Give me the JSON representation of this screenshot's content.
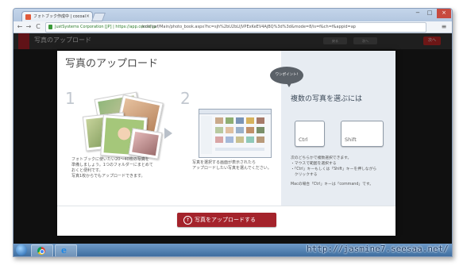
{
  "browser": {
    "tab_title": "フォトブック作成中 | cocoal",
    "close_glyph": "×",
    "url_secure": "JustSystems Corporation [JP] | https://app.cocoal.jp",
    "url_rest": "/edit/swf/Main/photo_book.aspx?hc=sjh%2bU2bLIJVPExKeEV4AjBQ%3d%3d&mode=8/is=f&ch=f&appid=ap",
    "back_glyph": "←",
    "forward_glyph": "→",
    "reload_glyph": "C",
    "menu_glyph": "≡",
    "min_glyph": "−",
    "max_glyph": "□",
    "close_win_glyph": "×"
  },
  "app": {
    "title": "写真のアップロード",
    "btn1": "戻る",
    "btn2": "次へ",
    "red_btn": "次へ"
  },
  "modal": {
    "title": "写真のアップロード",
    "step1_num": "1",
    "step2_num": "2",
    "step1_desc": [
      "フォトブックに使いたい20～40枚の写真を",
      "準備しましょう。1つのフォルダーにまとめて",
      "おくと便利です。",
      "写真1枚からでもアップロードできます。"
    ],
    "step2_desc": [
      "写真を選択する画面が表示されたら",
      "アップロードしたい写真を選んでください。"
    ],
    "balloon": "ワンポイント!",
    "right_title": "複数の写真を選ぶには",
    "key_ctrl": "Ctrl",
    "key_shift": "Shift",
    "right_desc": [
      "次のどちらかで複数選択できます。",
      "・マウスで範囲を選択する",
      "・「Ctrl」キーもしくは「Shift」キーを押しながら",
      "　クリックする",
      "",
      "Macの場合「Ctrl」キーは「command」です。"
    ],
    "upload_icon": "↑",
    "upload_button": "写真をアップロードする"
  },
  "watermark": "http://jasmine7.seesaa.net/"
}
